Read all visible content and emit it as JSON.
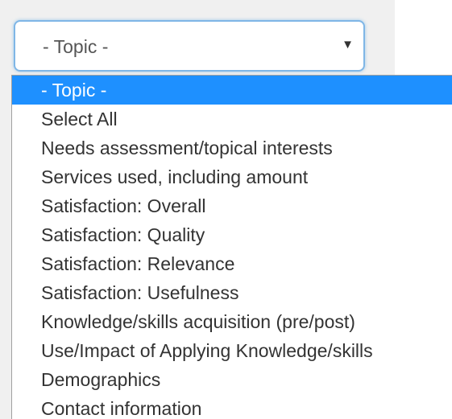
{
  "select": {
    "value": "- Topic -",
    "arrow": "▼"
  },
  "options": [
    "- Topic -",
    "Select All",
    "Needs assessment/topical interests",
    "Services used, including amount",
    "Satisfaction: Overall",
    "Satisfaction: Quality",
    "Satisfaction: Relevance",
    "Satisfaction: Usefulness",
    "Knowledge/skills acquisition (pre/post)",
    "Use/Impact of Applying Knowledge/skills",
    "Demographics",
    "Contact information"
  ],
  "selected_index": 0,
  "colors": {
    "highlight": "#1e90ff",
    "text": "#333333",
    "focus_border": "#7fb6e6"
  }
}
